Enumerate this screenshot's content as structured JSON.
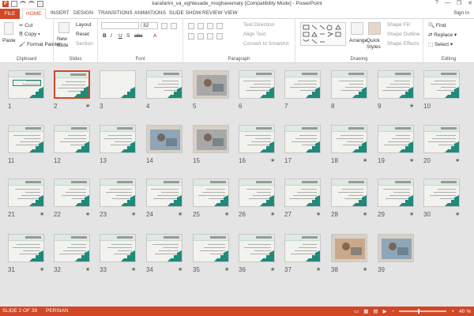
{
  "window": {
    "title": "karafarini_va_eghtesade_moghavematy [Compatibility Mode] - PowerPoint",
    "controls": [
      "?",
      "—",
      "❐",
      "✕"
    ]
  },
  "ribbon_tabs": [
    "FILE",
    "HOME",
    "INSERT",
    "DESIGN",
    "TRANSITIONS",
    "ANIMATIONS",
    "SLIDE SHOW",
    "REVIEW",
    "VIEW"
  ],
  "active_tab": "HOME",
  "sign_in": "Sign in",
  "clipboard": {
    "paste": "Paste",
    "cut": "Cut",
    "copy": "Copy",
    "format_painter": "Format Painter",
    "label": "Clipboard"
  },
  "slides_group": {
    "new_slide": "New Slide",
    "layout": "Layout",
    "reset": "Reset",
    "section": "Section",
    "label": "Slides"
  },
  "font_group": {
    "font_size": "32",
    "label": "Font"
  },
  "paragraph_group": {
    "text_direction": "Text Direction",
    "align_text": "Align Text",
    "convert_smartart": "Convert to SmartArt",
    "label": "Paragraph"
  },
  "drawing_group": {
    "arrange": "Arrange",
    "quick_styles": "Quick Styles",
    "shape_fill": "Shape Fill",
    "shape_outline": "Shape Outline",
    "shape_effects": "Shape Effects",
    "label": "Drawing"
  },
  "editing_group": {
    "find": "Find",
    "replace": "Replace",
    "select": "Select",
    "label": "Editing"
  },
  "slides": [
    {
      "n": "1",
      "star": false,
      "kind": "title"
    },
    {
      "n": "2",
      "star": true,
      "kind": "text",
      "selected": true
    },
    {
      "n": "3",
      "star": false,
      "kind": "blank"
    },
    {
      "n": "4",
      "star": false,
      "kind": "text"
    },
    {
      "n": "5",
      "star": false,
      "kind": "photo"
    },
    {
      "n": "6",
      "star": false,
      "kind": "text"
    },
    {
      "n": "7",
      "star": false,
      "kind": "text"
    },
    {
      "n": "8",
      "star": false,
      "kind": "text"
    },
    {
      "n": "9",
      "star": true,
      "kind": "text"
    },
    {
      "n": "10",
      "star": false,
      "kind": "text"
    },
    {
      "n": "11",
      "star": false,
      "kind": "text"
    },
    {
      "n": "12",
      "star": false,
      "kind": "text"
    },
    {
      "n": "13",
      "star": false,
      "kind": "text"
    },
    {
      "n": "14",
      "star": false,
      "kind": "photo"
    },
    {
      "n": "15",
      "star": false,
      "kind": "photo"
    },
    {
      "n": "16",
      "star": true,
      "kind": "text"
    },
    {
      "n": "17",
      "star": false,
      "kind": "text"
    },
    {
      "n": "18",
      "star": true,
      "kind": "text"
    },
    {
      "n": "19",
      "star": true,
      "kind": "text"
    },
    {
      "n": "20",
      "star": true,
      "kind": "text"
    },
    {
      "n": "21",
      "star": true,
      "kind": "text"
    },
    {
      "n": "22",
      "star": true,
      "kind": "text"
    },
    {
      "n": "23",
      "star": true,
      "kind": "text"
    },
    {
      "n": "24",
      "star": true,
      "kind": "text"
    },
    {
      "n": "25",
      "star": true,
      "kind": "text"
    },
    {
      "n": "26",
      "star": true,
      "kind": "text"
    },
    {
      "n": "27",
      "star": true,
      "kind": "text"
    },
    {
      "n": "28",
      "star": true,
      "kind": "text"
    },
    {
      "n": "29",
      "star": true,
      "kind": "text"
    },
    {
      "n": "30",
      "star": true,
      "kind": "text"
    },
    {
      "n": "31",
      "star": true,
      "kind": "text"
    },
    {
      "n": "32",
      "star": true,
      "kind": "text"
    },
    {
      "n": "33",
      "star": true,
      "kind": "text"
    },
    {
      "n": "34",
      "star": true,
      "kind": "text"
    },
    {
      "n": "35",
      "star": true,
      "kind": "text"
    },
    {
      "n": "36",
      "star": true,
      "kind": "text"
    },
    {
      "n": "37",
      "star": true,
      "kind": "text"
    },
    {
      "n": "38",
      "star": true,
      "kind": "photo"
    },
    {
      "n": "39",
      "star": false,
      "kind": "photo"
    }
  ],
  "status": {
    "slide_info": "SLIDE 2 OF 39",
    "language": "PERSIAN",
    "zoom": "40 %"
  },
  "colors": {
    "accent": "#d24726",
    "teal": "#1f8a7a",
    "header": "#dfe9e4"
  }
}
